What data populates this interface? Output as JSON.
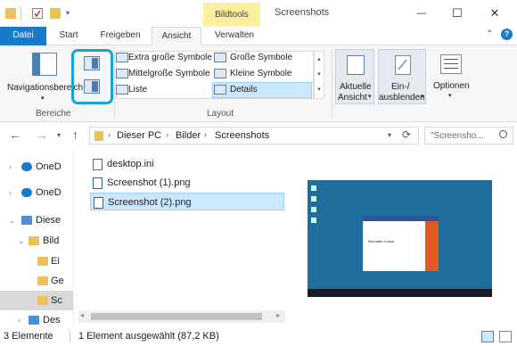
{
  "title_bar": {
    "context_tab": "Bildtools",
    "window_title": "Screenshots",
    "minimize": "—",
    "maximize": "☐",
    "close": "✕"
  },
  "tabs": [
    "Datei",
    "Start",
    "Freigeben",
    "Ansicht",
    "Verwalten"
  ],
  "ribbon": {
    "bereiche": {
      "nav_label": "Navigationsbereich",
      "group_label": "Bereiche"
    },
    "layout": {
      "items": [
        "Extra große Symbole",
        "Große Symbole",
        "Mittelgroße Symbole",
        "Kleine Symbole",
        "Liste",
        "Details"
      ],
      "group_label": "Layout"
    },
    "aktuelle_ansicht": [
      "Aktuelle",
      "Ansicht"
    ],
    "einausblenden": [
      "Ein-/",
      "ausblenden"
    ],
    "optionen": "Optionen"
  },
  "address": {
    "path": [
      "Dieser PC",
      "Bilder",
      "Screenshots"
    ],
    "search_placeholder": "\"Screensho..."
  },
  "nav_pane": [
    "OneD",
    "OneD",
    "Diese",
    "Bild",
    "Ei",
    "Ge",
    "Sc",
    "Des"
  ],
  "files": [
    "desktop.ini",
    "Screenshot (1).png",
    "Screenshot (2).png"
  ],
  "status": {
    "count": "3 Elemente",
    "selection": "1 Element ausgewählt (87,2 KB)"
  },
  "preview": {
    "dialog_text": "Normaler Cursor"
  },
  "colors": {
    "datei_tab": "#1979ca",
    "bildtools": "#fcf09c",
    "highlight": "#19a2d8",
    "selected_row": "#cce8ff",
    "desktop_teal": "#1f6d9a"
  }
}
